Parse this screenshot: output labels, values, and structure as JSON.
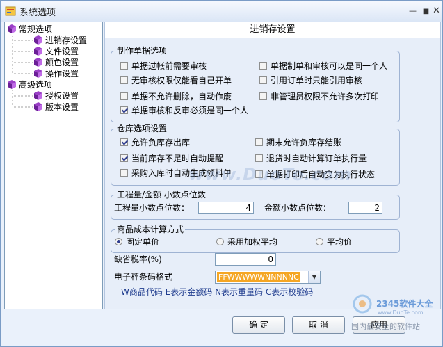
{
  "window": {
    "title": "系统选项"
  },
  "tree": {
    "items": [
      {
        "label": "常规选项",
        "level": 0
      },
      {
        "label": "进销存设置",
        "level": 1
      },
      {
        "label": "文件设置",
        "level": 1
      },
      {
        "label": "颜色设置",
        "level": 1
      },
      {
        "label": "操作设置",
        "level": 1
      },
      {
        "label": "高级选项",
        "level": 0
      },
      {
        "label": "授权设置",
        "level": 1
      },
      {
        "label": "版本设置",
        "level": 1
      }
    ]
  },
  "panel": {
    "header": "进销存设置",
    "doc_group": {
      "title": "制作单据选项",
      "options": [
        {
          "label": "单据过帐前需要审核",
          "checked": false
        },
        {
          "label": "单据制单和审核可以是同一个人",
          "checked": false
        },
        {
          "label": "无审核权限仅能看自己开单",
          "checked": false
        },
        {
          "label": "引用订单时只能引用审核",
          "checked": false
        },
        {
          "label": "单据不允许删除，自动作废",
          "checked": false
        },
        {
          "label": "非管理员权限不允许多次打印",
          "checked": false
        },
        {
          "label": "单据审核和反审必须是同一个人",
          "checked": true
        }
      ]
    },
    "stock_group": {
      "title": "仓库选项设置",
      "options": [
        {
          "label": "允许负库存出库",
          "checked": true
        },
        {
          "label": "期末允许负库存结账",
          "checked": false
        },
        {
          "label": "当前库存不足时自动提醒",
          "checked": true
        },
        {
          "label": "退货时自动计算订单执行量",
          "checked": false
        },
        {
          "label": "采购入库时自动生成领料单",
          "checked": false
        },
        {
          "label": "单据打印后自动变为执行状态",
          "checked": false
        }
      ]
    },
    "decimal_group": {
      "title": "工程量/金额 小数点位数",
      "qty_label": "工程量小数点位数：",
      "qty_value": "4",
      "amount_label": "金额小数点位数：",
      "amount_value": "2"
    },
    "cost_group": {
      "title": "商品成本计算方式",
      "options": [
        {
          "label": "固定单价",
          "selected": true
        },
        {
          "label": "采用加权平均",
          "selected": false
        },
        {
          "label": "平均价",
          "selected": false
        }
      ]
    },
    "tax": {
      "label": "缺省税率(%)",
      "value": "0"
    },
    "barcode": {
      "label": "电子秤条码格式",
      "value": "FFWWWWWNNNNNC"
    },
    "hint": "W商品代码 E表示金额码 N表示重量码 C表示校验码"
  },
  "buttons": {
    "ok": "确 定",
    "cancel": "取 消",
    "apply": "应用"
  },
  "watermarks": {
    "center": "www.DuoTe.com",
    "corner_site": "www.DuoTe.com",
    "corner_brand": "2345软件大全",
    "corner_sub": "国内最安全的软件站"
  }
}
